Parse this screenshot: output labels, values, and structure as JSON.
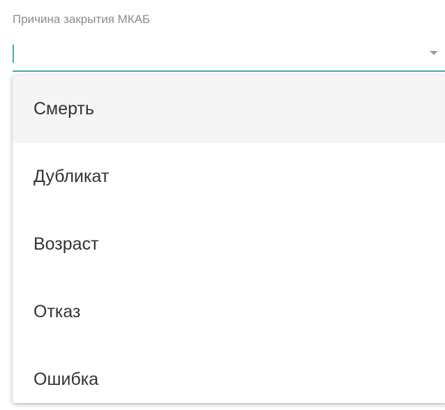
{
  "field": {
    "label": "Причина закрытия МКАБ",
    "value": "",
    "dropdown_icon": "triangle-down-icon"
  },
  "dropdown": {
    "options": [
      {
        "label": "Смерть",
        "highlighted": true
      },
      {
        "label": "Дубликат",
        "highlighted": false
      },
      {
        "label": "Возраст",
        "highlighted": false
      },
      {
        "label": "Отказ",
        "highlighted": false
      },
      {
        "label": "Ошибка",
        "highlighted": false
      }
    ]
  },
  "colors": {
    "accent": "#45a6b4",
    "label": "#8c8c8c",
    "option_text": "#333333",
    "highlight_bg": "#f5f5f5"
  }
}
